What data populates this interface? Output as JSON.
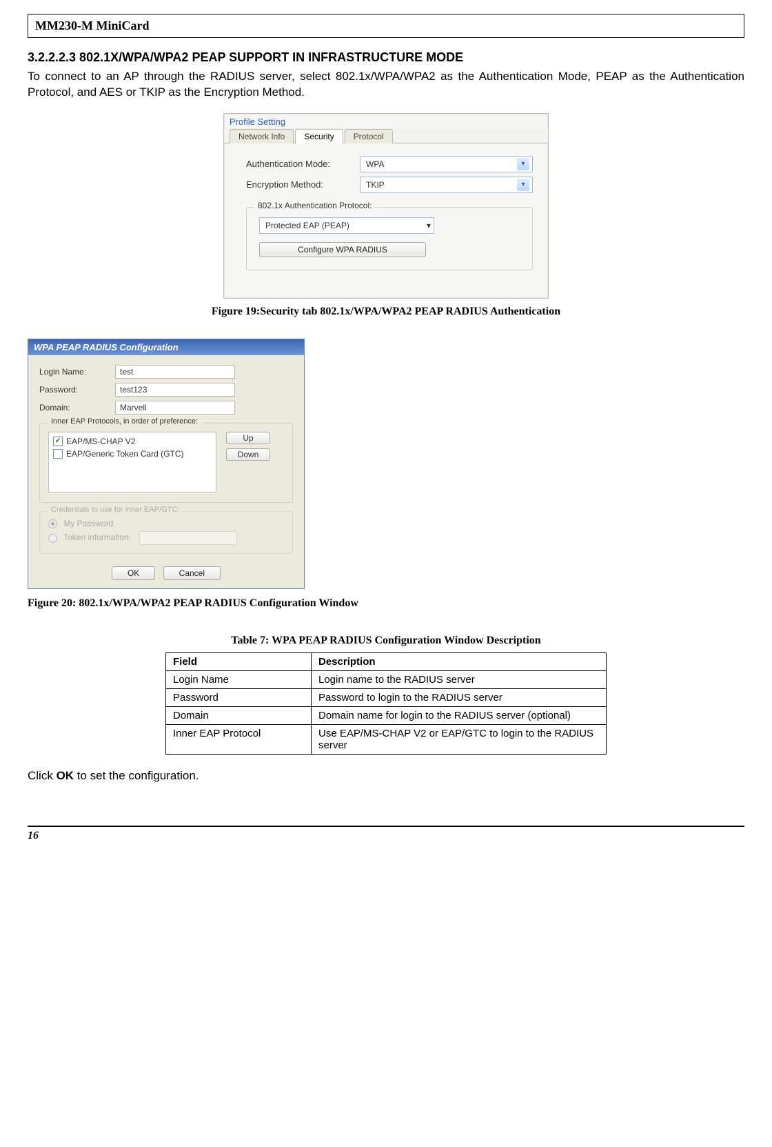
{
  "header": {
    "title": "MM230-M MiniCard"
  },
  "section": {
    "heading": "3.2.2.2.3 802.1X/WPA/WPA2 PEAP SUPPORT IN INFRASTRUCTURE MODE",
    "paragraph": "To connect to an AP through the RADIUS server, select 802.1x/WPA/WPA2 as the Authentication Mode, PEAP as the Authentication Protocol, and AES or TKIP as the Encryption Method."
  },
  "profile_dialog": {
    "title": "Profile Setting",
    "tabs": [
      "Network Info",
      "Security",
      "Protocol"
    ],
    "active_tab": "Security",
    "auth_mode_label": "Authentication Mode:",
    "auth_mode_value": "WPA",
    "enc_label": "Encryption Method:",
    "enc_value": "TKIP",
    "group_title": "802.1x Authentication Protocol:",
    "protocol_value": "Protected EAP (PEAP)",
    "configure_btn": "Configure WPA RADIUS"
  },
  "figure19_caption": "Figure 19:Security tab 802.1x/WPA/WPA2 PEAP RADIUS Authentication",
  "radius_dialog": {
    "title": "WPA PEAP RADIUS Configuration",
    "login_label": "Login Name:",
    "login_value": "test",
    "password_label": "Password:",
    "password_value": "test123",
    "domain_label": "Domain:",
    "domain_value": "Marvell",
    "inner_title": "Inner EAP Protocols, in order of preference:",
    "item1": "EAP/MS-CHAP V2",
    "item2": "EAP/Generic Token Card (GTC)",
    "up_btn": "Up",
    "down_btn": "Down",
    "cred_title": "Credentials to use for inner EAP/GTC:",
    "cred_opt1": "My Password",
    "cred_opt2": "Token information:",
    "ok_btn": "OK",
    "cancel_btn": "Cancel"
  },
  "figure20_caption": "Figure 20: 802.1x/WPA/WPA2 PEAP RADIUS Configuration Window",
  "table": {
    "caption": "Table 7: WPA PEAP RADIUS Configuration Window Description",
    "headers": {
      "field": "Field",
      "desc": "Description"
    },
    "rows": [
      {
        "field": "Login Name",
        "desc": "Login name to the RADIUS server"
      },
      {
        "field": "Password",
        "desc": "Password to login to the RADIUS server"
      },
      {
        "field": "Domain",
        "desc": "Domain name for login to the RADIUS server (optional)"
      },
      {
        "field": "Inner EAP Protocol",
        "desc": "Use EAP/MS-CHAP V2 or EAP/GTC to login to the RADIUS server"
      }
    ]
  },
  "closing_text_pre": "Click ",
  "closing_text_bold": "OK",
  "closing_text_post": " to set the configuration.",
  "page_number": "16"
}
